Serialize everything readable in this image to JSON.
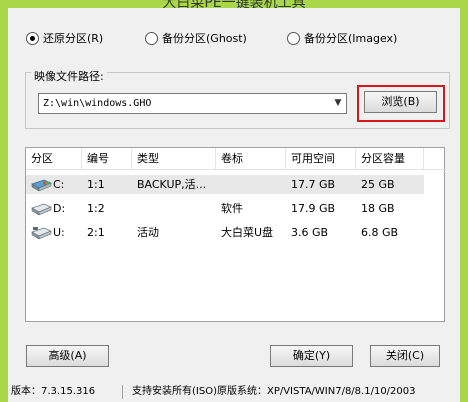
{
  "window": {
    "title": "大白菜PE一键装机工具"
  },
  "mode_options": [
    {
      "label": "还原分区(R)",
      "checked": true
    },
    {
      "label": "备份分区(Ghost)",
      "checked": false
    },
    {
      "label": "备份分区(Imagex)",
      "checked": false
    }
  ],
  "image_path": {
    "group_label": "映像文件路径:",
    "value": "Z:\\win\\windows.GHO",
    "browse_label": "浏览(B)"
  },
  "partition_table": {
    "headers": [
      "分区",
      "编号",
      "类型",
      "卷标",
      "可用空间",
      "分区容量"
    ],
    "rows": [
      {
        "drive": "C:",
        "number": "1:1",
        "type": "BACKUP,活...",
        "label": "",
        "free": "17.7 GB",
        "capacity": "25 GB",
        "icon": "system-disk-icon"
      },
      {
        "drive": "D:",
        "number": "1:2",
        "type": "",
        "label": "软件",
        "free": "17.9 GB",
        "capacity": "18 GB",
        "icon": "hard-disk-icon"
      },
      {
        "drive": "U:",
        "number": "2:1",
        "type": "活动",
        "label": "大白菜U盘",
        "free": "3.6 GB",
        "capacity": "6.8 GB",
        "icon": "usb-disk-icon"
      }
    ]
  },
  "buttons": {
    "advanced": "高级(A)",
    "ok": "确定(Y)",
    "close": "关闭(C)"
  },
  "status": {
    "version": "版本：7.3.15.316",
    "os_support": "支持安装所有(ISO)原版系统：XP/VISTA/WIN7/8/8.1/10/2003"
  },
  "colors": {
    "accent_green": "#a8d84a",
    "highlight_red": "#d8171d",
    "selected_row": "#e8e8e8"
  }
}
